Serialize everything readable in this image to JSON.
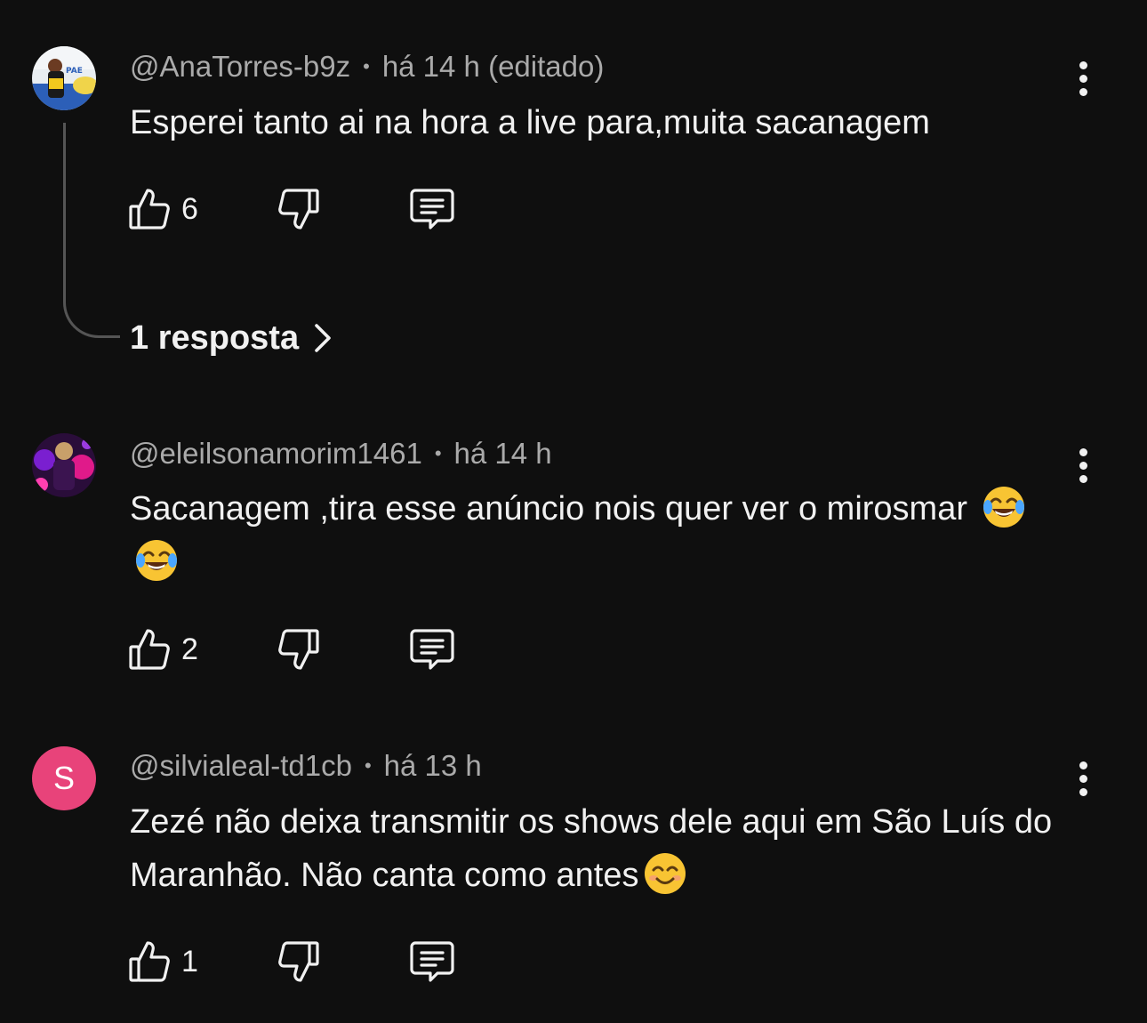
{
  "comments": [
    {
      "author": "@AnaTorres-b9z",
      "time": "há 14 h (editado)",
      "text": "Esperei tanto ai na hora a live para,muita sacanagem",
      "likes": "6",
      "avatar_badge": "PAE",
      "replies_label": "1 resposta"
    },
    {
      "author": "@eleilsonamorim1461",
      "time": "há 14 h",
      "text": "Sacanagem ,tira esse anúncio nois quer ver o mirosmar",
      "likes": "2"
    },
    {
      "author": "@silvialeal-td1cb",
      "time": "há 13 h",
      "text": "Zezé não deixa transmitir os shows dele aqui em São Luís do Maranhão. Não canta como antes",
      "likes": "1",
      "avatar_letter": "S"
    }
  ],
  "separator": "•",
  "icons": {
    "like": "thumbs-up-icon",
    "dislike": "thumbs-down-icon",
    "reply": "comment-icon",
    "menu": "more-vertical-icon",
    "chevron": "chevron-right-icon",
    "emoji_laugh": "tears-of-joy-emoji",
    "emoji_smile": "smiling-face-emoji"
  },
  "colors": {
    "background": "#0f0f0f",
    "text": "#f1f1f1",
    "secondary_text": "#aaaaaa",
    "avatar_s": "#e8437a"
  }
}
